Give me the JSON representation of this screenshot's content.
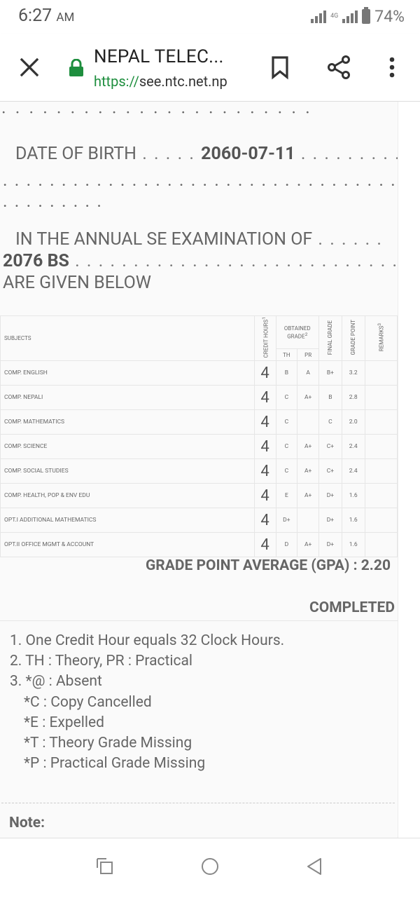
{
  "status_bar": {
    "time": "6:27",
    "ampm": "AM",
    "network": "4G",
    "battery": "74%"
  },
  "toolbar": {
    "title": "NEPAL TELEC...",
    "url_scheme": "https://",
    "url_host": "see.ntc.net.np"
  },
  "page": {
    "dob_label": "DATE OF BIRTH",
    "dob_value": "2060-07-11",
    "exam_text": "IN THE ANNUAL SE EXAMINATION OF",
    "exam_year": "2076 BS",
    "given_below": "ARE GIVEN BELOW"
  },
  "table": {
    "headers": {
      "subjects": "SUBJECTS",
      "credit_hours": "CREDIT HOURS",
      "credit_sup": "1",
      "obtained_grade": "OBTAINED GRADE",
      "obtained_sup": "2",
      "th": "TH",
      "pr": "PR",
      "final_grade": "FINAL GRADE",
      "grade_point": "GRADE POINT",
      "remarks": "REMARKS",
      "remarks_sup": "3"
    },
    "rows": [
      {
        "subject": "COMP. ENGLISH",
        "credit": "4",
        "th": "B",
        "pr": "A",
        "final": "B+",
        "gp": "3.2"
      },
      {
        "subject": "COMP. NEPALI",
        "credit": "4",
        "th": "C",
        "pr": "A+",
        "final": "B",
        "gp": "2.8"
      },
      {
        "subject": "COMP. MATHEMATICS",
        "credit": "4",
        "th": "C",
        "pr": "",
        "final": "C",
        "gp": "2.0"
      },
      {
        "subject": "COMP. SCIENCE",
        "credit": "4",
        "th": "C",
        "pr": "A+",
        "final": "C+",
        "gp": "2.4"
      },
      {
        "subject": "COMP. SOCIAL STUDIES",
        "credit": "4",
        "th": "C",
        "pr": "A+",
        "final": "C+",
        "gp": "2.4"
      },
      {
        "subject": "COMP. HEALTH, POP & ENV EDU",
        "credit": "4",
        "th": "E",
        "pr": "A+",
        "final": "D+",
        "gp": "1.6"
      },
      {
        "subject": "OPT.I ADDITIONAL MATHEMATICS",
        "credit": "4",
        "th": "D+",
        "pr": "",
        "final": "D+",
        "gp": "1.6"
      },
      {
        "subject": "OPT.II OFFICE MGMT & ACCOUNT",
        "credit": "4",
        "th": "D",
        "pr": "A+",
        "final": "D+",
        "gp": "1.6"
      }
    ]
  },
  "gpa": "GRADE POINT AVERAGE (GPA) : 2.20",
  "completed": "COMPLETED",
  "notes": [
    "1. One Credit Hour equals 32 Clock Hours.",
    "2. TH : Theory, PR : Practical",
    "3. *@ : Absent",
    "*C : Copy Cancelled",
    "*E : Expelled",
    "*T : Theory Grade Missing",
    "*P : Practical Grade Missing"
  ],
  "note_label": "Note:"
}
